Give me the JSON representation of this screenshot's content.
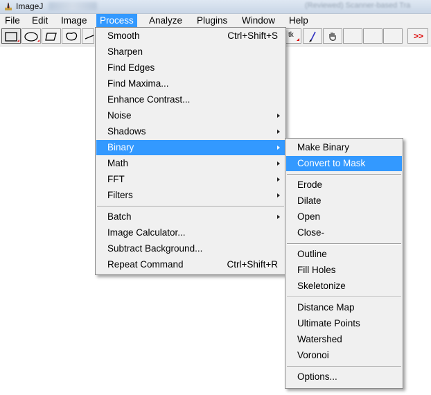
{
  "window": {
    "title": "ImageJ",
    "status_blur": "(Reviewed) Scanner-based Tra"
  },
  "menubar": {
    "items": [
      "File",
      "Edit",
      "Image",
      "Process",
      "Analyze",
      "Plugins",
      "Window",
      "Help"
    ],
    "active": "Process"
  },
  "toolbar": {
    "tools": [
      "rectangle-select",
      "oval-select",
      "polygon-select",
      "freehand-select",
      "line",
      "text",
      "brush",
      "hand",
      "more"
    ],
    "more_label": ">>",
    "text_tool_label": "tk"
  },
  "process_menu": {
    "items": [
      {
        "label": "Smooth",
        "shortcut": "Ctrl+Shift+S"
      },
      {
        "label": "Sharpen"
      },
      {
        "label": "Find Edges"
      },
      {
        "label": "Find Maxima..."
      },
      {
        "label": "Enhance Contrast..."
      },
      {
        "label": "Noise",
        "submenu": true
      },
      {
        "label": "Shadows",
        "submenu": true
      },
      {
        "label": "Binary",
        "submenu": true,
        "highlighted": true
      },
      {
        "label": "Math",
        "submenu": true
      },
      {
        "label": "FFT",
        "submenu": true
      },
      {
        "label": "Filters",
        "submenu": true
      },
      {
        "label": "Batch",
        "submenu": true
      },
      {
        "label": "Image Calculator..."
      },
      {
        "label": "Subtract Background..."
      },
      {
        "label": "Repeat Command",
        "shortcut": "Ctrl+Shift+R"
      }
    ]
  },
  "binary_menu": {
    "items": [
      {
        "label": "Make Binary"
      },
      {
        "label": "Convert to Mask",
        "highlighted": true
      },
      {
        "label": "Erode"
      },
      {
        "label": "Dilate"
      },
      {
        "label": "Open"
      },
      {
        "label": "Close-"
      },
      {
        "label": "Outline"
      },
      {
        "label": "Fill Holes"
      },
      {
        "label": "Skeletonize"
      },
      {
        "label": "Distance Map"
      },
      {
        "label": "Ultimate Points"
      },
      {
        "label": "Watershed"
      },
      {
        "label": "Voronoi"
      },
      {
        "label": "Options..."
      }
    ]
  },
  "colors": {
    "highlight": "#3399ff",
    "menu_bg": "#f0f0f0"
  }
}
